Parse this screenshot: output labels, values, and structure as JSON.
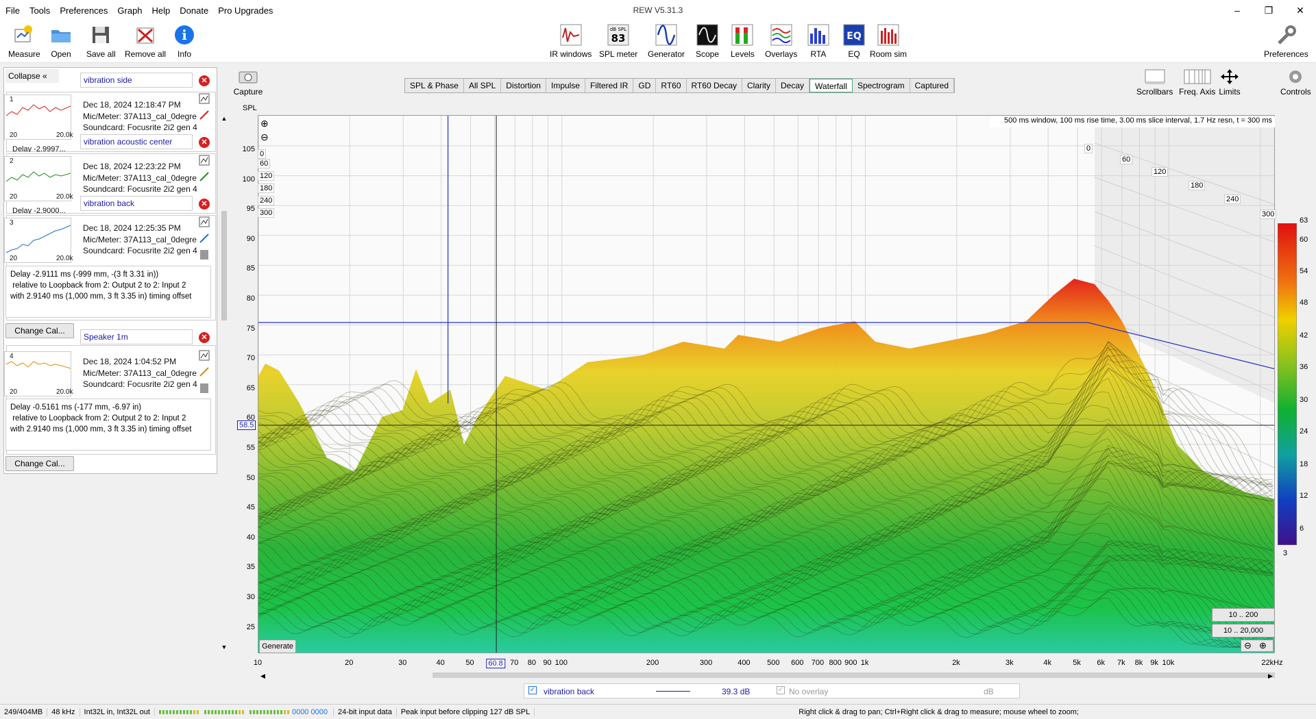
{
  "menu": [
    "File",
    "Tools",
    "Preferences",
    "Graph",
    "Help",
    "Donate",
    "Pro Upgrades"
  ],
  "app_title": "REW V5.31.3",
  "window_buttons": [
    "–",
    "❐",
    "✕"
  ],
  "toolbar_left": [
    {
      "label": "Measure",
      "icon": "measure-icon"
    },
    {
      "label": "Open",
      "icon": "folder-icon"
    },
    {
      "label": "Save all",
      "icon": "save-icon"
    },
    {
      "label": "Remove all",
      "icon": "remove-icon"
    },
    {
      "label": "Info",
      "icon": "info-icon"
    }
  ],
  "toolbar_center": [
    {
      "label": "IR windows"
    },
    {
      "label": "SPL meter",
      "badge_top": "dB SPL",
      "badge_value": "83"
    },
    {
      "label": "Generator"
    },
    {
      "label": "Scope"
    },
    {
      "label": "Levels"
    },
    {
      "label": "Overlays"
    },
    {
      "label": "RTA"
    },
    {
      "label": "EQ",
      "badge_value": "EQ"
    },
    {
      "label": "Room sim"
    }
  ],
  "toolbar_right": {
    "label": "Preferences"
  },
  "collapse_label": "Collapse",
  "measurements": [
    {
      "num": "1",
      "name": "vibration side",
      "date": "Dec 18, 2024 12:18:47 PM",
      "mic": "Mic/Meter: 37A113_cal_0degre",
      "sound": "Soundcard: Focusrite 2i2 gen 4",
      "lo": "20",
      "hi": "20.0k",
      "color": "#d42020",
      "delay_peek": "Delay -2.9997..."
    },
    {
      "num": "2",
      "name": "vibration acoustic center",
      "date": "Dec 18, 2024 12:23:22 PM",
      "mic": "Mic/Meter: 37A113_cal_0degre",
      "sound": "Soundcard: Focusrite 2i2 gen 4",
      "lo": "20",
      "hi": "20.0k",
      "color": "#1f8a1f",
      "delay_peek": "Delay -2.9000..."
    },
    {
      "num": "3",
      "name": "vibration back",
      "date": "Dec 18, 2024 12:25:35 PM",
      "mic": "Mic/Meter: 37A113_cal_0degre",
      "sound": "Soundcard: Focusrite 2i2 gen 4",
      "lo": "20",
      "hi": "20.0k",
      "color": "#1f6fd4",
      "delay": [
        "Delay -2.9111 ms (-999 mm, -(3 ft 3.31 in))",
        " relative to Loopback from 2: Output 2 to 2: Input 2",
        "with 2.9140 ms (1,000 mm, 3 ft 3.35 in) timing offset"
      ]
    },
    {
      "num": "4",
      "name": "Speaker 1m",
      "date": "Dec 18, 2024 1:04:52 PM",
      "mic": "Mic/Meter: 37A113_cal_0degre",
      "sound": "Soundcard: Focusrite 2i2 gen 4",
      "lo": "20",
      "hi": "20.0k",
      "color": "#e08a10",
      "delay": [
        "Delay -0.5161 ms (-177 mm, -6.97 in)",
        " relative to Loopback from 2: Output 2 to 2: Input 2",
        "with 2.9140 ms (1,000 mm, 3 ft 3.35 in) timing offset"
      ]
    }
  ],
  "change_cal_label": "Change Cal...",
  "capture_label": "Capture",
  "spl_label": "SPL",
  "graph_tabs": [
    "SPL & Phase",
    "All SPL",
    "Distortion",
    "Impulse",
    "Filtered IR",
    "GD",
    "RT60",
    "RT60 Decay",
    "Clarity",
    "Decay",
    "Waterfall",
    "Spectrogram",
    "Captured"
  ],
  "active_tab": "Waterfall",
  "right_tools": [
    {
      "label": "Scrollbars"
    },
    {
      "label": "Freq. Axis"
    },
    {
      "label": "Limits"
    },
    {
      "label": "Controls"
    }
  ],
  "info_text": "500 ms window, 100 ms rise time, 3.00 ms slice interval, 1.7 Hz resn, t = 300 ms",
  "y_ticks": [
    "105",
    "100",
    "95",
    "90",
    "85",
    "80",
    "75",
    "70",
    "65",
    "60",
    "55",
    "50",
    "45",
    "40",
    "35",
    "30",
    "25"
  ],
  "x_ticks": [
    "10",
    "20",
    "30",
    "40",
    "50",
    "60.8",
    "70",
    "80",
    "90",
    "100",
    "200",
    "300",
    "400",
    "500",
    "600",
    "700",
    "800",
    "900",
    "1k",
    "2k",
    "3k",
    "4k",
    "5k",
    "6k",
    "7k",
    "8k",
    "9k",
    "10k",
    "22kHz"
  ],
  "cursor_y_value": "58.5",
  "cursor_x_value": "60.8",
  "time_ticks_left": [
    "0",
    "60",
    "120",
    "180",
    "240",
    "300"
  ],
  "time_ticks_right": [
    "0",
    "60",
    "120",
    "180",
    "240",
    "300"
  ],
  "scale_ticks": [
    "63",
    "60",
    "54",
    "48",
    "42",
    "36",
    "30",
    "24",
    "18",
    "12",
    "6",
    "3"
  ],
  "range_buttons": [
    "10 .. 200",
    "10 .. 20,000"
  ],
  "generate_label": "Generate",
  "bottom_panel": {
    "checked_label": "vibration back",
    "value": "39.3 dB",
    "overlay_label": "No overlay",
    "unit": "dB"
  },
  "status": [
    "249/404MB",
    "48 kHz",
    "Int32L in, Int32L out",
    "0000 0000",
    "24-bit input data",
    "Peak input before clipping 127 dB SPL"
  ],
  "status_hint": "Right click & drag to pan; Ctrl+Right click & drag to measure; mouse wheel to zoom;"
}
